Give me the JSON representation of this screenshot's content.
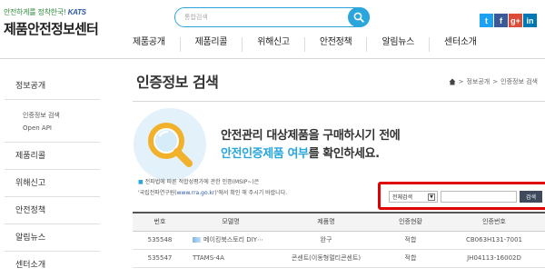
{
  "header": {
    "slogan": "안전하게를 정착한국!",
    "kats": "KATS",
    "site_title": "제품안전정보센터",
    "search_placeholder": "통합검색"
  },
  "social": {
    "twitter": "t",
    "facebook": "f",
    "google": "g+",
    "other": "in"
  },
  "nav": {
    "items": [
      "제품공개",
      "제품리콜",
      "위해신고",
      "안전정책",
      "알림뉴스",
      "센터소개"
    ]
  },
  "lnb": {
    "top": "정보공개",
    "sub": [
      "인증정보 검색",
      "Open API"
    ],
    "items": [
      "제품리콜",
      "위해신고",
      "안전정책",
      "알림뉴스",
      "센터소개"
    ]
  },
  "page": {
    "title": "인증정보 검색",
    "breadcrumb": [
      "정보공개",
      "인증정보 검색"
    ]
  },
  "banner": {
    "line1": "안전관리 대상제품을 구매하시기 전에",
    "line2_highlight": "안전인증제품 여부",
    "line2_rest": "를 확인하세요."
  },
  "notice": {
    "line1": "전파법에 따른 적합성평가에 관한 인증(MSIP~)은",
    "line2_pre": "'국립전파연구원(",
    "line2_link": "www.rra.go.kr",
    "line2_post": ")'에서 확인 해 주시기 바랍니다."
  },
  "search": {
    "select_value": "전체검색",
    "input_value": "",
    "button_label": "검색"
  },
  "table": {
    "headers": [
      "번호",
      "모델명",
      "제품명",
      "인증현황",
      "인증번호"
    ],
    "rows": [
      {
        "no": "535548",
        "model": "메이킹북스토리 DIY⋯",
        "product": "완구",
        "status": "적합",
        "cert": "CB063H131-7001"
      },
      {
        "no": "535547",
        "model": "TTAMS-4A",
        "product": "콘센트(이동형멀티콘센트)",
        "status": "적합",
        "cert": "JH04113-16002D"
      }
    ]
  },
  "colors": {
    "accent": "#2aa6dc",
    "highlight_box": "#e00000",
    "search_button": "#3f4a5c"
  }
}
